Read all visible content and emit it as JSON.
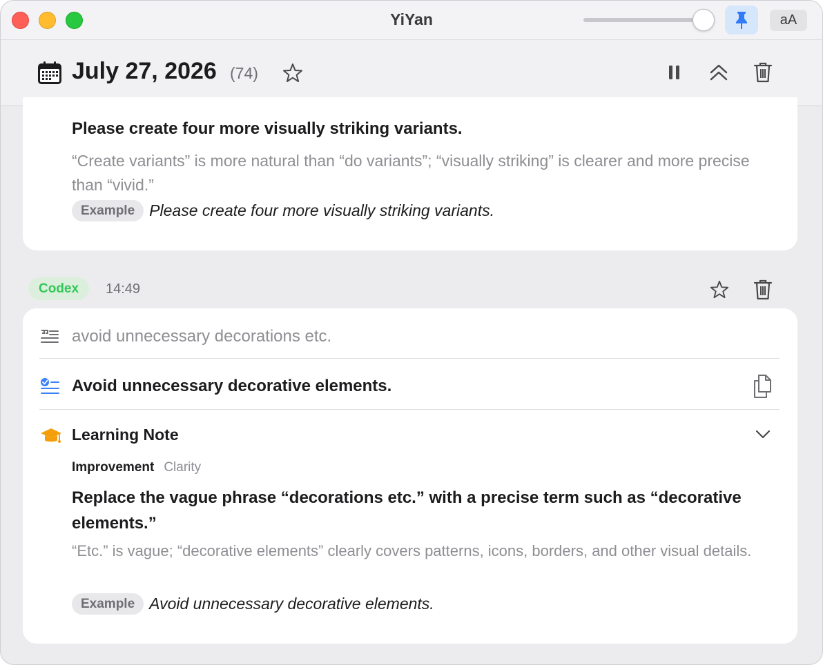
{
  "window": {
    "title": "YiYan",
    "font_size_label": "aA",
    "slider_value": 1.0
  },
  "header": {
    "date": "July 27, 2026",
    "count": "(74)"
  },
  "card_prev": {
    "corrected": "Please create four more visually striking variants.",
    "explanation": "“Create variants” is more natural than “do variants”; “visually striking” is clearer and more precise than “vivid.”",
    "example_label": "Example",
    "example_text": "Please create four more visually striking variants."
  },
  "entry": {
    "source": "Codex",
    "time": "14:49",
    "original": "avoid unnecessary decorations etc.",
    "corrected": "Avoid unnecessary decorative elements.",
    "note_title": "Learning Note",
    "improvement_label": "Improvement",
    "category": "Clarity",
    "suggestion": "Replace the vague phrase “decorations etc.” with a precise term such as “decorative elements.”",
    "explanation": "“Etc.” is vague; “decorative elements” clearly covers patterns, icons, borders, and other visual details.",
    "example_label": "Example",
    "example_text": "Avoid unnecessary decorative elements."
  },
  "colors": {
    "accent_blue": "#3b82f6",
    "source_green": "#34c759",
    "note_orange": "#f59e0b"
  },
  "icons": [
    "calendar-icon",
    "star-icon",
    "pause-icon",
    "collapse-icon",
    "trash-icon",
    "pin-icon",
    "quote-icon",
    "checklist-icon",
    "copy-icon",
    "graduation-cap-icon",
    "chevron-down-icon"
  ]
}
